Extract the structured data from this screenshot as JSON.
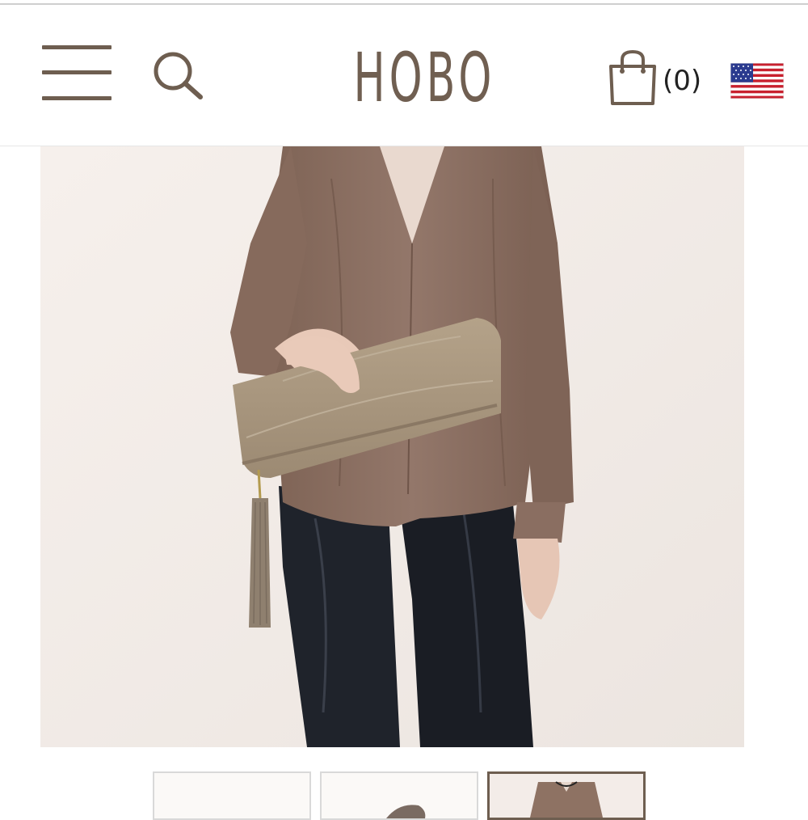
{
  "header": {
    "brand": "HOBO",
    "cart_count": "(0)",
    "menu_icon": "hamburger-menu-icon",
    "search_icon": "search-icon",
    "cart_icon": "shopping-bag-icon",
    "flag_icon": "us-flag-icon"
  },
  "colors": {
    "brand": "#705f51",
    "blouse": "#8c6f62",
    "clutch": "#a7947c",
    "jeans": "#1d2027",
    "background": "#f2ece7"
  },
  "thumbnails": [
    {
      "name": "thumbnail-1"
    },
    {
      "name": "thumbnail-2"
    },
    {
      "name": "thumbnail-3",
      "active": true
    }
  ]
}
